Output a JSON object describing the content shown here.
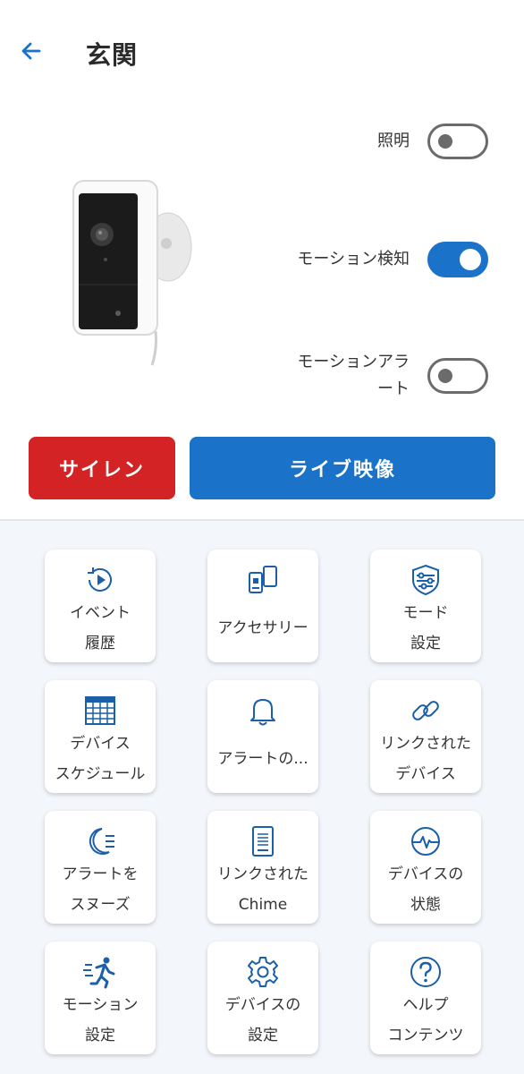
{
  "header": {
    "title": "玄関",
    "back_icon": "arrow-left-icon"
  },
  "toggles": {
    "light": {
      "label": "照明",
      "state": "off"
    },
    "motion_detect": {
      "label": "モーション検知",
      "state": "on"
    },
    "motion_alert": {
      "label_line1": "モーションアラ",
      "label_line2": "ート",
      "state": "off"
    }
  },
  "actions": {
    "siren_label": "サイレン",
    "live_label": "ライブ映像"
  },
  "colors": {
    "accent": "#1a73c8",
    "danger": "#d32324",
    "grid_bg": "#f3f6fb"
  },
  "tiles": [
    {
      "icon": "play-history-icon",
      "line1": "イベント",
      "line2": "履歴"
    },
    {
      "icon": "accessories-icon",
      "line1": "アクセサリー",
      "line2": ""
    },
    {
      "icon": "mode-settings-icon",
      "line1": "モード",
      "line2": "設定"
    },
    {
      "icon": "calendar-icon",
      "line1": "デバイス",
      "line2": "スケジュール"
    },
    {
      "icon": "bell-icon",
      "line1": "アラートの...",
      "line2": ""
    },
    {
      "icon": "link-icon",
      "line1": "リンクされた",
      "line2": "デバイス"
    },
    {
      "icon": "snooze-moon-icon",
      "line1": "アラートを",
      "line2": "スヌーズ"
    },
    {
      "icon": "chime-icon",
      "line1": "リンクされた",
      "line2": "Chime"
    },
    {
      "icon": "health-pulse-icon",
      "line1": "デバイスの",
      "line2": "状態"
    },
    {
      "icon": "running-person-icon",
      "line1": "モーション",
      "line2": "設定"
    },
    {
      "icon": "gear-icon",
      "line1": "デバイスの",
      "line2": "設定"
    },
    {
      "icon": "help-icon",
      "line1": "ヘルプ",
      "line2": "コンテンツ"
    }
  ]
}
